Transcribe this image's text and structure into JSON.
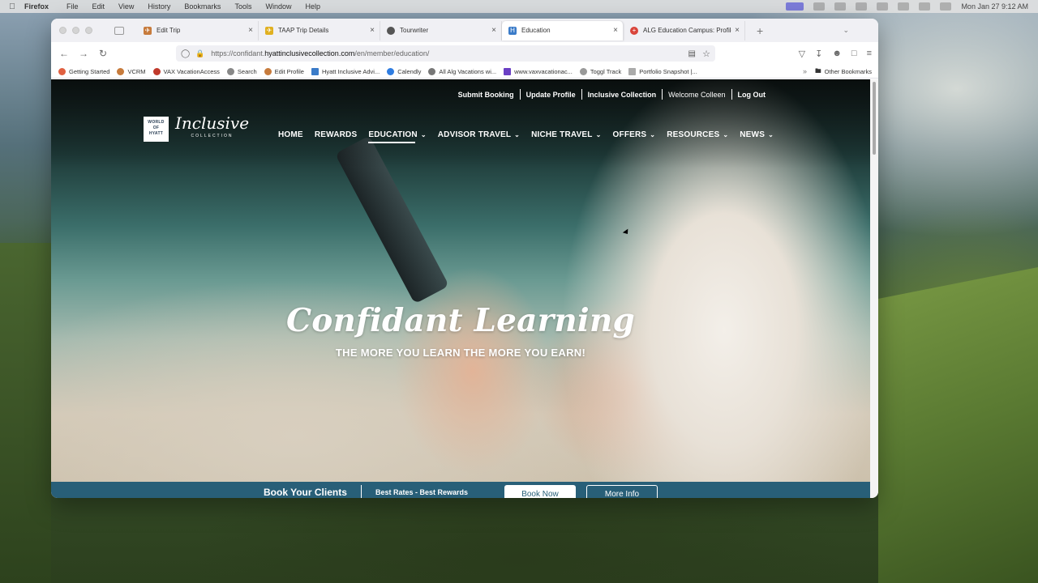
{
  "menubar": {
    "app": "Firefox",
    "items": [
      "File",
      "Edit",
      "View",
      "History",
      "Bookmarks",
      "Tools",
      "Window",
      "Help"
    ],
    "datetime": "Mon Jan 27  9:12 AM"
  },
  "browser": {
    "tabs": [
      {
        "title": "Edit Trip",
        "favicon_color": "#c77b3c"
      },
      {
        "title": "TAAP Trip Details",
        "favicon_color": "#e0b020"
      },
      {
        "title": "Tourwriter",
        "favicon_color": "#555555"
      },
      {
        "title": "Education",
        "favicon_color": "#3a7bc8"
      },
      {
        "title": "ALG Education Campus: Profile",
        "favicon_color": "#d9443a"
      }
    ],
    "url": {
      "prefix": "https://confidant.",
      "domain": "hyattinclusivecollection.com",
      "path": "/en/member/education/"
    },
    "bookmarks": [
      "Getting Started",
      "VCRM",
      "VAX VacationAccess",
      "Search",
      "Edit Profile",
      "Hyatt Inclusive Advi...",
      "Calendly",
      "All Alg Vacations wi...",
      "www.vaxvacationac...",
      "Toggl Track",
      "Portfolio Snapshot |..."
    ],
    "other_bookmarks": "Other Bookmarks"
  },
  "site": {
    "utility_nav": [
      "Submit Booking",
      "Update Profile",
      "Inclusive Collection",
      "Welcome Colleen",
      "Log Out"
    ],
    "logo": {
      "box_lines": [
        "WORLD",
        "OF",
        "HYATT"
      ],
      "script": "Inclusive",
      "sub": "COLLECTION"
    },
    "main_nav": [
      {
        "label": "HOME",
        "dropdown": false
      },
      {
        "label": "REWARDS",
        "dropdown": false
      },
      {
        "label": "EDUCATION",
        "dropdown": true
      },
      {
        "label": "ADVISOR TRAVEL",
        "dropdown": true
      },
      {
        "label": "NICHE TRAVEL",
        "dropdown": true
      },
      {
        "label": "OFFERS",
        "dropdown": true
      },
      {
        "label": "RESOURCES",
        "dropdown": true
      },
      {
        "label": "NEWS",
        "dropdown": true
      }
    ],
    "hero": {
      "title": "Confidant Learning",
      "subtitle": "THE MORE YOU LEARN THE MORE YOU EARN!"
    },
    "bookbar": {
      "title": "Book Your Clients",
      "rates": "Best Rates - Best Rewards",
      "book_now": "Book Now",
      "more_info": "More Info"
    }
  },
  "colors": {
    "bookbar_bg": "#285f78",
    "accent": "#ffffff"
  }
}
